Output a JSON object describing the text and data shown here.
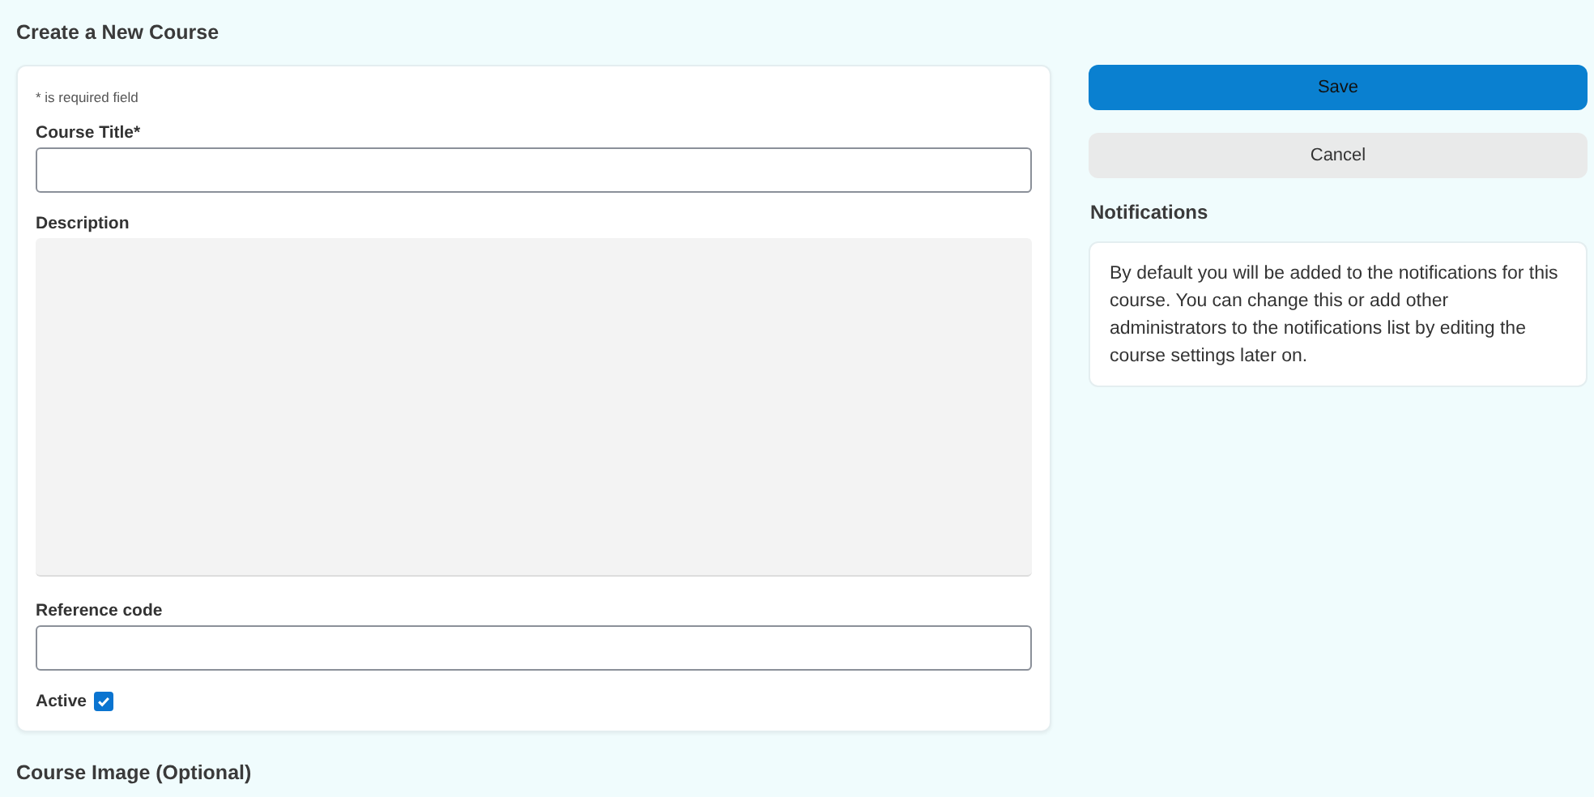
{
  "page_title": "Create a New Course",
  "form": {
    "required_note": "* is required field",
    "fields": [
      {
        "kind": "text",
        "label": "Course Title*"
      },
      {
        "kind": "textarea",
        "label": "Description"
      },
      {
        "kind": "text",
        "label": "Reference code"
      },
      {
        "kind": "checkbox",
        "label": "Active",
        "checked": true
      }
    ]
  },
  "section_title": "Course Image (Optional)",
  "buttons": [
    {
      "kind": "primary",
      "label": "Save"
    },
    {
      "kind": "secondary",
      "label": "Cancel"
    }
  ],
  "notifications": {
    "title": "Notifications",
    "text": "By default you will be added to the notifications for this course. You can change this or add other administrators to the notifications list by editing the course settings later on."
  }
}
